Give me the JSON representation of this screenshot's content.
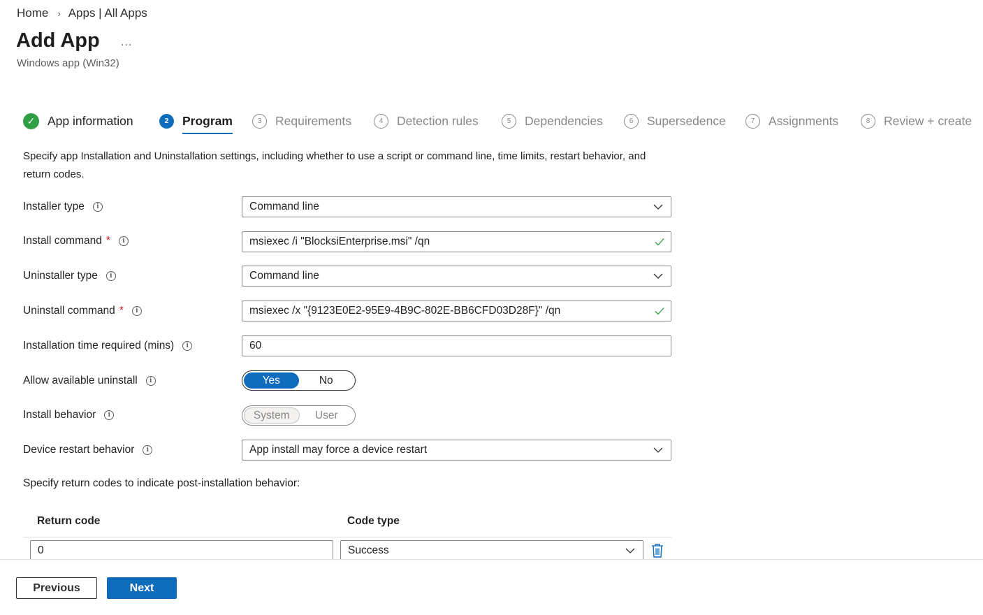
{
  "breadcrumb": {
    "home": "Home",
    "separator": "›",
    "apps": "Apps | All Apps"
  },
  "header": {
    "title": "Add App",
    "more": "...",
    "subtitle": "Windows app (Win32)"
  },
  "wizard": {
    "steps": [
      {
        "num": "✓",
        "label": "App information",
        "state": "done"
      },
      {
        "num": "2",
        "label": "Program",
        "state": "active"
      },
      {
        "num": "3",
        "label": "Requirements",
        "state": "pending"
      },
      {
        "num": "4",
        "label": "Detection rules",
        "state": "pending"
      },
      {
        "num": "5",
        "label": "Dependencies",
        "state": "pending"
      },
      {
        "num": "6",
        "label": "Supersedence",
        "state": "pending"
      },
      {
        "num": "7",
        "label": "Assignments",
        "state": "pending"
      },
      {
        "num": "8",
        "label": "Review + create",
        "state": "pending"
      }
    ]
  },
  "description": "Specify app Installation and Uninstallation settings, including whether to use a script or command line, time limits, restart behavior, and return codes.",
  "form": {
    "installer_type": {
      "label": "Installer type",
      "value": "Command line"
    },
    "install_command": {
      "label": "Install command",
      "required": "*",
      "value": "msiexec /i \"BlocksiEnterprise.msi\" /qn"
    },
    "uninstaller_type": {
      "label": "Uninstaller type",
      "value": "Command line"
    },
    "uninstall_command": {
      "label": "Uninstall command",
      "required": "*",
      "value": "msiexec /x \"{9123E0E2-95E9-4B9C-802E-BB6CFD03D28F}\" /qn"
    },
    "install_time": {
      "label": "Installation time required (mins)",
      "value": "60"
    },
    "allow_uninstall": {
      "label": "Allow available uninstall",
      "yes": "Yes",
      "no": "No",
      "selected": "Yes"
    },
    "install_behavior": {
      "label": "Install behavior",
      "system": "System",
      "user": "User",
      "selected": "System"
    },
    "restart_behavior": {
      "label": "Device restart behavior",
      "value": "App install may force a device restart"
    }
  },
  "return_codes": {
    "note": "Specify return codes to indicate post-installation behavior:",
    "col_return_code": "Return code",
    "col_code_type": "Code type",
    "rows": [
      {
        "code": "0",
        "type": "Success"
      }
    ]
  },
  "footer": {
    "previous": "Previous",
    "next": "Next"
  },
  "colors": {
    "accent": "#0f6cbd",
    "success": "#2f9e45",
    "required": "#c50f1f"
  },
  "icons": {
    "info": "info-icon",
    "chevron": "chevron-down-icon",
    "check": "checkmark-icon",
    "trash": "trash-icon"
  }
}
